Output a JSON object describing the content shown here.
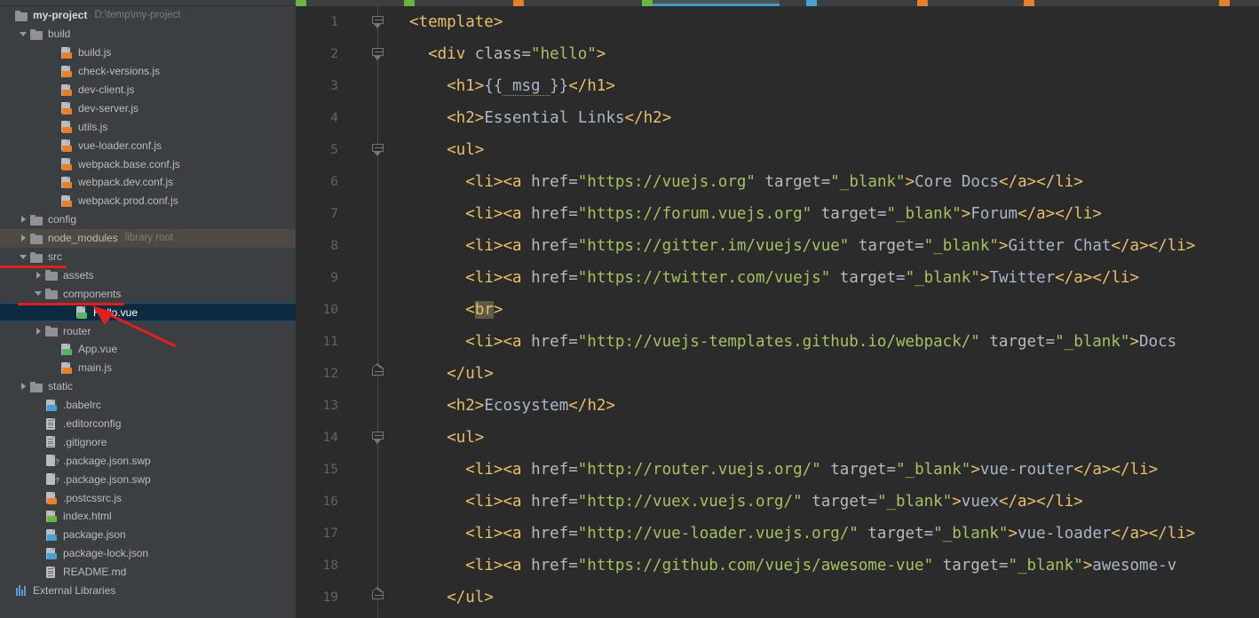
{
  "project": {
    "name": "my-project",
    "path": "D:\\temp\\my-project",
    "external_libraries_label": "External Libraries"
  },
  "colors": {
    "sidebar_bg": "#3c3f41",
    "editor_bg": "#2b2b2b",
    "selection_bg": "#0d2b3e",
    "selection_border": "#1b4f72",
    "library_root_bg": "#4e4a43",
    "annotation_red": "#e02020",
    "tag": "#e8bf6a",
    "string": "#a5c261",
    "text": "#a9b7c6",
    "line_number": "#606366",
    "active_tab_underline": "#3d9ac6"
  },
  "tree": [
    {
      "label": "my-project",
      "sub": "D:\\temp\\my-project",
      "indent": 0,
      "arrow": "none",
      "icon": "folder",
      "kind": "project"
    },
    {
      "label": "build",
      "sub": "",
      "indent": 1,
      "arrow": "open",
      "icon": "folder",
      "kind": "folder"
    },
    {
      "label": "build.js",
      "sub": "",
      "indent": 3,
      "arrow": "none",
      "icon": "file-js",
      "kind": "file"
    },
    {
      "label": "check-versions.js",
      "sub": "",
      "indent": 3,
      "arrow": "none",
      "icon": "file-js",
      "kind": "file"
    },
    {
      "label": "dev-client.js",
      "sub": "",
      "indent": 3,
      "arrow": "none",
      "icon": "file-js",
      "kind": "file"
    },
    {
      "label": "dev-server.js",
      "sub": "",
      "indent": 3,
      "arrow": "none",
      "icon": "file-js",
      "kind": "file"
    },
    {
      "label": "utils.js",
      "sub": "",
      "indent": 3,
      "arrow": "none",
      "icon": "file-js",
      "kind": "file"
    },
    {
      "label": "vue-loader.conf.js",
      "sub": "",
      "indent": 3,
      "arrow": "none",
      "icon": "file-js",
      "kind": "file"
    },
    {
      "label": "webpack.base.conf.js",
      "sub": "",
      "indent": 3,
      "arrow": "none",
      "icon": "file-js",
      "kind": "file"
    },
    {
      "label": "webpack.dev.conf.js",
      "sub": "",
      "indent": 3,
      "arrow": "none",
      "icon": "file-js",
      "kind": "file"
    },
    {
      "label": "webpack.prod.conf.js",
      "sub": "",
      "indent": 3,
      "arrow": "none",
      "icon": "file-js",
      "kind": "file"
    },
    {
      "label": "config",
      "sub": "",
      "indent": 1,
      "arrow": "closed",
      "icon": "folder",
      "kind": "folder"
    },
    {
      "label": "node_modules",
      "sub": "library root",
      "indent": 1,
      "arrow": "closed",
      "icon": "folder",
      "kind": "folder-libroot"
    },
    {
      "label": "src",
      "sub": "",
      "indent": 1,
      "arrow": "open",
      "icon": "folder",
      "kind": "folder"
    },
    {
      "label": "assets",
      "sub": "",
      "indent": 2,
      "arrow": "closed",
      "icon": "folder",
      "kind": "folder"
    },
    {
      "label": "components",
      "sub": "",
      "indent": 2,
      "arrow": "open",
      "icon": "folder",
      "kind": "folder"
    },
    {
      "label": "Hello.vue",
      "sub": "",
      "indent": 4,
      "arrow": "none",
      "icon": "file-vue",
      "kind": "file-selected"
    },
    {
      "label": "router",
      "sub": "",
      "indent": 2,
      "arrow": "closed",
      "icon": "folder",
      "kind": "folder"
    },
    {
      "label": "App.vue",
      "sub": "",
      "indent": 3,
      "arrow": "none",
      "icon": "file-vue",
      "kind": "file"
    },
    {
      "label": "main.js",
      "sub": "",
      "indent": 3,
      "arrow": "none",
      "icon": "file-js",
      "kind": "file"
    },
    {
      "label": "static",
      "sub": "",
      "indent": 1,
      "arrow": "closed",
      "icon": "folder",
      "kind": "folder"
    },
    {
      "label": ".babelrc",
      "sub": "",
      "indent": 2,
      "arrow": "none",
      "icon": "file-json",
      "kind": "file"
    },
    {
      "label": ".editorconfig",
      "sub": "",
      "indent": 2,
      "arrow": "none",
      "icon": "file-text",
      "kind": "file"
    },
    {
      "label": ".gitignore",
      "sub": "",
      "indent": 2,
      "arrow": "none",
      "icon": "file-text",
      "kind": "file"
    },
    {
      "label": ".package.json.swp",
      "sub": "",
      "indent": 2,
      "arrow": "none",
      "icon": "file-swp",
      "kind": "file"
    },
    {
      "label": ".package.json.swp",
      "sub": "",
      "indent": 2,
      "arrow": "none",
      "icon": "file-swp",
      "kind": "file"
    },
    {
      "label": ".postcssrc.js",
      "sub": "",
      "indent": 2,
      "arrow": "none",
      "icon": "file-js",
      "kind": "file"
    },
    {
      "label": "index.html",
      "sub": "",
      "indent": 2,
      "arrow": "none",
      "icon": "file-html",
      "kind": "file"
    },
    {
      "label": "package.json",
      "sub": "",
      "indent": 2,
      "arrow": "none",
      "icon": "file-json",
      "kind": "file"
    },
    {
      "label": "package-lock.json",
      "sub": "",
      "indent": 2,
      "arrow": "none",
      "icon": "file-json",
      "kind": "file"
    },
    {
      "label": "README.md",
      "sub": "",
      "indent": 2,
      "arrow": "none",
      "icon": "file-text",
      "kind": "file"
    },
    {
      "label": "External Libraries",
      "sub": "",
      "indent": 0,
      "arrow": "none",
      "icon": "ext-lib",
      "kind": "extlib"
    }
  ],
  "editor": {
    "file": "Hello.vue",
    "first_line": 1,
    "last_line": 19,
    "line_numbers": [
      1,
      2,
      3,
      4,
      5,
      6,
      7,
      8,
      9,
      10,
      11,
      12,
      13,
      14,
      15,
      16,
      17,
      18,
      19
    ],
    "selected_token": "br",
    "folds": [
      {
        "line": 1,
        "type": "down"
      },
      {
        "line": 2,
        "type": "down"
      },
      {
        "line": 5,
        "type": "down"
      },
      {
        "line": 12,
        "type": "up"
      },
      {
        "line": 14,
        "type": "down"
      },
      {
        "line": 19,
        "type": "up"
      }
    ],
    "lines": [
      "<template>",
      "  <div class=\"hello\">",
      "    <h1>{{ msg }}</h1>",
      "    <h2>Essential Links</h2>",
      "    <ul>",
      "      <li><a href=\"https://vuejs.org\" target=\"_blank\">Core Docs</a></li>",
      "      <li><a href=\"https://forum.vuejs.org\" target=\"_blank\">Forum</a></li>",
      "      <li><a href=\"https://gitter.im/vuejs/vue\" target=\"_blank\">Gitter Chat</a></li>",
      "      <li><a href=\"https://twitter.com/vuejs\" target=\"_blank\">Twitter</a></li>",
      "      <br>",
      "      <li><a href=\"http://vuejs-templates.github.io/webpack/\" target=\"_blank\">Docs",
      "    </ul>",
      "    <h2>Ecosystem</h2>",
      "    <ul>",
      "      <li><a href=\"http://router.vuejs.org/\" target=\"_blank\">vue-router</a></li>",
      "      <li><a href=\"http://vuex.vuejs.org/\" target=\"_blank\">vuex</a></li>",
      "      <li><a href=\"http://vue-loader.vuejs.org/\" target=\"_blank\">vue-loader</a></li>",
      "      <li><a href=\"https://github.com/vuejs/awesome-vue\" target=\"_blank\">awesome-v",
      "    </ul>"
    ]
  },
  "annotations": {
    "underline_src": "red underline under src folder",
    "underline_components": "red underline under components folder",
    "arrow_target": "Hello.vue"
  }
}
